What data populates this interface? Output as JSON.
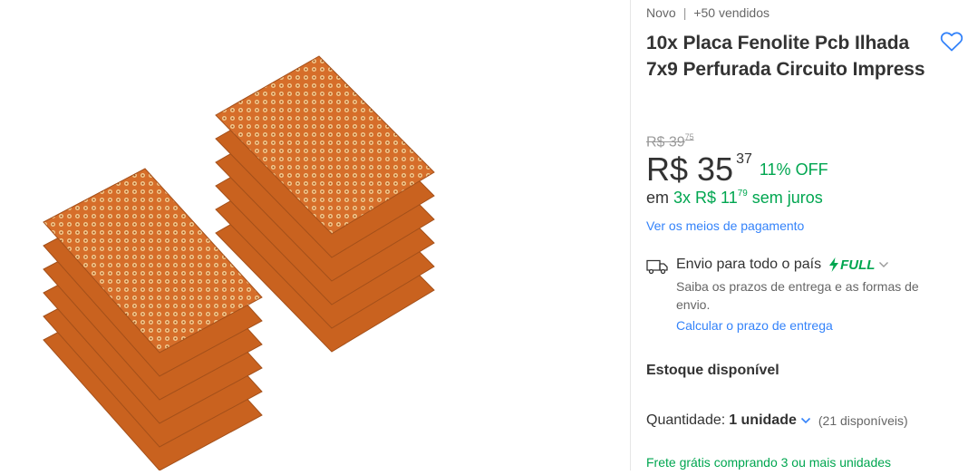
{
  "header": {
    "condition": "Novo",
    "sold": "+50 vendidos"
  },
  "product": {
    "title": "10x Placa Fenolite Pcb Ilhada 7x9 Perfurada Circuito Impress"
  },
  "price": {
    "original_main": "R$ 39",
    "original_cents": "75",
    "current_main": "R$ 35",
    "current_cents": "37",
    "discount": "11% OFF"
  },
  "installments": {
    "prefix": "em",
    "amount": "3x R$ 11",
    "cents": "79",
    "suffix": "sem juros"
  },
  "payment_link": "Ver os meios de pagamento",
  "shipping": {
    "title": "Envio para todo o país",
    "badge": "FULL",
    "description": "Saiba os prazos de entrega e as formas de envio.",
    "link": "Calcular o prazo de entrega"
  },
  "stock": {
    "label": "Estoque disponível"
  },
  "quantity": {
    "label": "Quantidade:",
    "value": "1 unidade",
    "available": "(21 disponíveis)"
  },
  "free_shipping": "Frete grátis comprando 3 ou mais unidades",
  "colors": {
    "brand_green": "#00a650",
    "link_blue": "#3483fa",
    "pcb_orange": "#d9702a"
  },
  "icons": [
    "heart-icon",
    "truck-icon",
    "lightning-icon",
    "chevron-down-icon"
  ]
}
